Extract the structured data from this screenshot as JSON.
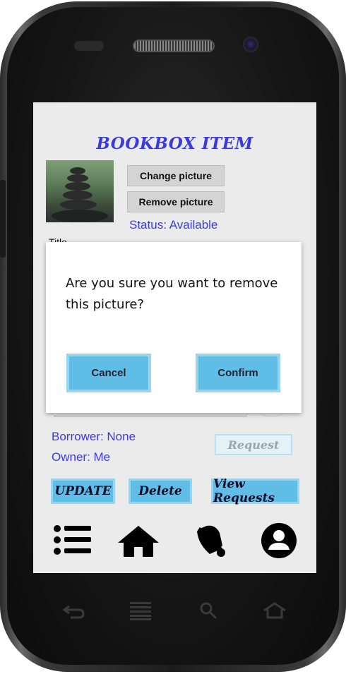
{
  "screen": {
    "title": "BOOKBOX ITEM",
    "buttons": {
      "change_picture": "Change picture",
      "remove_picture": "Remove picture"
    },
    "status": "Status: Available",
    "title_label": "Title",
    "borrower": "Borrower: None",
    "owner": "Owner: Me",
    "request": "Request",
    "actions": {
      "update": "UPDATE",
      "delete": "Delete",
      "view_requests": "View Requests"
    },
    "bottom_nav": [
      "list-icon",
      "home-icon",
      "bell-icon",
      "profile-icon"
    ]
  },
  "dialog": {
    "message": "Are you sure you want to remove this picture?",
    "cancel": "Cancel",
    "confirm": "Confirm"
  },
  "colors": {
    "accent_text": "#3b3bdd",
    "button_blue": "#5fbde6",
    "button_border": "#97d5f0",
    "screen_bg": "#ebebeb"
  }
}
